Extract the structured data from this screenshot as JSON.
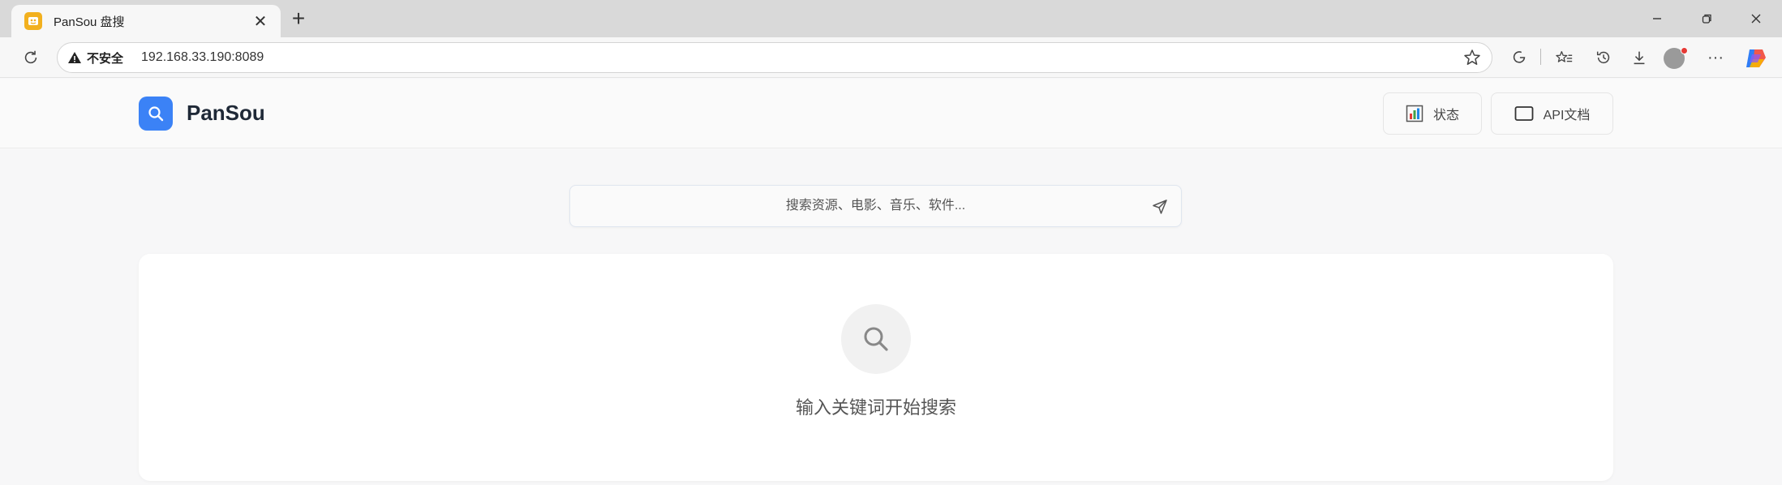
{
  "browser": {
    "tab_title": "PanSou 盘搜",
    "security_label": "不安全",
    "url": "192.168.33.190:8089"
  },
  "header": {
    "brand": "PanSou",
    "status_label": "状态",
    "api_docs_label": "API文档"
  },
  "search": {
    "placeholder": "搜索资源、电影、音乐、软件...",
    "value": ""
  },
  "empty_state": {
    "message": "输入关键词开始搜索"
  },
  "colors": {
    "accent": "#3b82f6",
    "favicon": "#f2b01e",
    "status_bar_1": "#e53935",
    "status_bar_2": "#43a047",
    "status_bar_3": "#1e88e5"
  }
}
